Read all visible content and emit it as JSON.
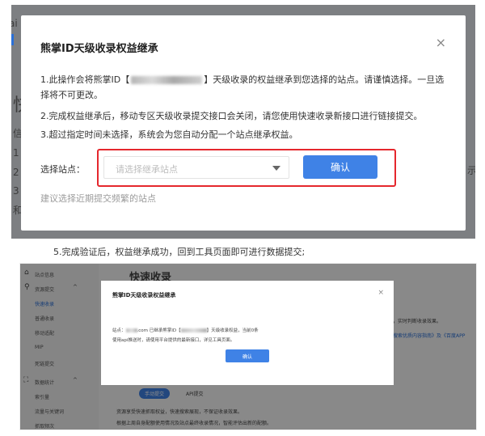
{
  "top_modal": {
    "title": "熊掌ID天级收录权益继承",
    "close_symbol": "×",
    "line1a": "1.此操作会将熊掌ID【",
    "line1b": "】天级收录的权益继承到您选择的站点。请谨慎选择。一旦选",
    "line1c": "择将不可更改。",
    "line2": "2.完成权益继承后，移动专区天级收录提交接口会关闭，请您使用快速收录新接口进行链接提交。",
    "line3": "3.超过指定时间未选择，系统会为您自动分配一个站点继承权益。",
    "site_label": "选择站点：",
    "select_placeholder": "请选择继承站点",
    "confirm_label": "确认",
    "hint": "建议选择近期提交频繁的站点"
  },
  "top_background": {
    "frag_left_top": "ai",
    "frag_left_big": "快",
    "frag_1": "信",
    "frag_2": "1",
    "frag_3": "2",
    "frag_4": "3",
    "frag_5": "和",
    "frag_right": "示"
  },
  "caption": "5.完成验证后，权益继承成功，回到工具页面即可进行数据提交;",
  "bottom": {
    "sidebar": {
      "site_info": "站点信息",
      "resource_submit": "资源提交",
      "fast_index": "快速收录",
      "normal_index": "普通收录",
      "mobile_adapt": "移动适配",
      "mip": "MIP",
      "dead_link": "死链提交",
      "data_stats": "数据统计",
      "index_volume": "索引量",
      "traffic_keywords": "流量与关键词",
      "crawl_freq": "抓取频次"
    },
    "page_title": "快速收录",
    "bg_right_1": "，实时判断收录效果。",
    "bg_right_2": "搜索优质内容指南》及《百度APP",
    "tab_active": "手动提交",
    "tab_other": "API提交",
    "bg_bottom_1": "资源享受快速抓取权益，快速搜索展现，不保证收录效果。",
    "bg_bottom_2": "根据上周自身配额使用情况及站点最终收录情况，智能评估出新的配额。",
    "modal": {
      "title": "熊掌ID天级收录权益继承",
      "close_symbol": "×",
      "line1a": "站点：",
      "line1b": ".com 已继承熊掌ID【",
      "line1c": "】天级收录权益，当前0条",
      "line2": "使用api推送时，请使用平台提供的最新接口，详见工具页面。",
      "confirm_label": "确认"
    }
  }
}
